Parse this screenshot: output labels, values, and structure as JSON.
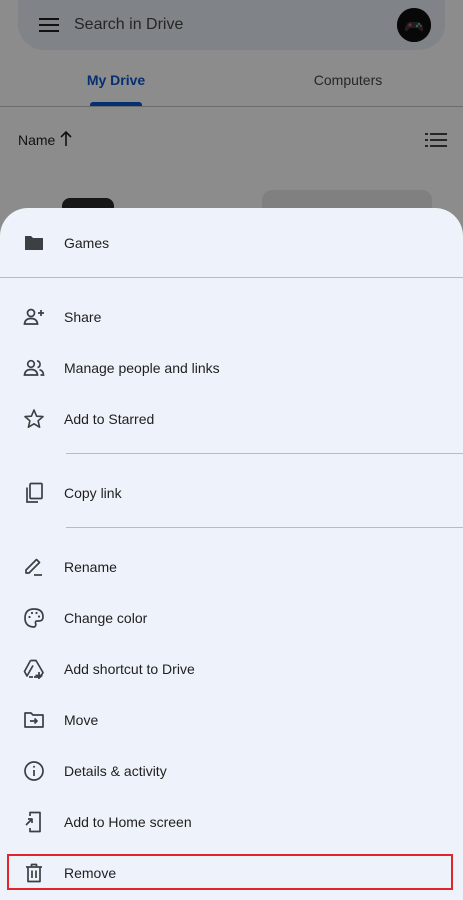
{
  "search": {
    "placeholder": "Search in Drive"
  },
  "tabs": [
    {
      "label": "My Drive",
      "selected": true
    },
    {
      "label": "Computers",
      "selected": false
    }
  ],
  "sort": {
    "label": "Name",
    "direction_icon": "arrow-up-icon",
    "view_icon": "list-view-icon"
  },
  "sheet": {
    "title": "Games",
    "title_icon": "folder-icon",
    "items": [
      {
        "label": "Share",
        "icon": "person-add-icon"
      },
      {
        "label": "Manage people and links",
        "icon": "people-icon"
      },
      {
        "label": "Add to Starred",
        "icon": "star-icon"
      },
      {
        "label": "Copy link",
        "icon": "copy-icon"
      },
      {
        "label": "Rename",
        "icon": "edit-icon"
      },
      {
        "label": "Change color",
        "icon": "palette-icon"
      },
      {
        "label": "Add shortcut to Drive",
        "icon": "add-to-drive-icon"
      },
      {
        "label": "Move",
        "icon": "move-to-folder-icon"
      },
      {
        "label": "Details & activity",
        "icon": "info-icon"
      },
      {
        "label": "Add to Home screen",
        "icon": "add-to-home-icon"
      },
      {
        "label": "Remove",
        "icon": "trash-icon"
      }
    ]
  },
  "colors": {
    "accent": "#0b57d0",
    "sheet_background": "#eef2fa",
    "highlight": "#e0262b"
  }
}
